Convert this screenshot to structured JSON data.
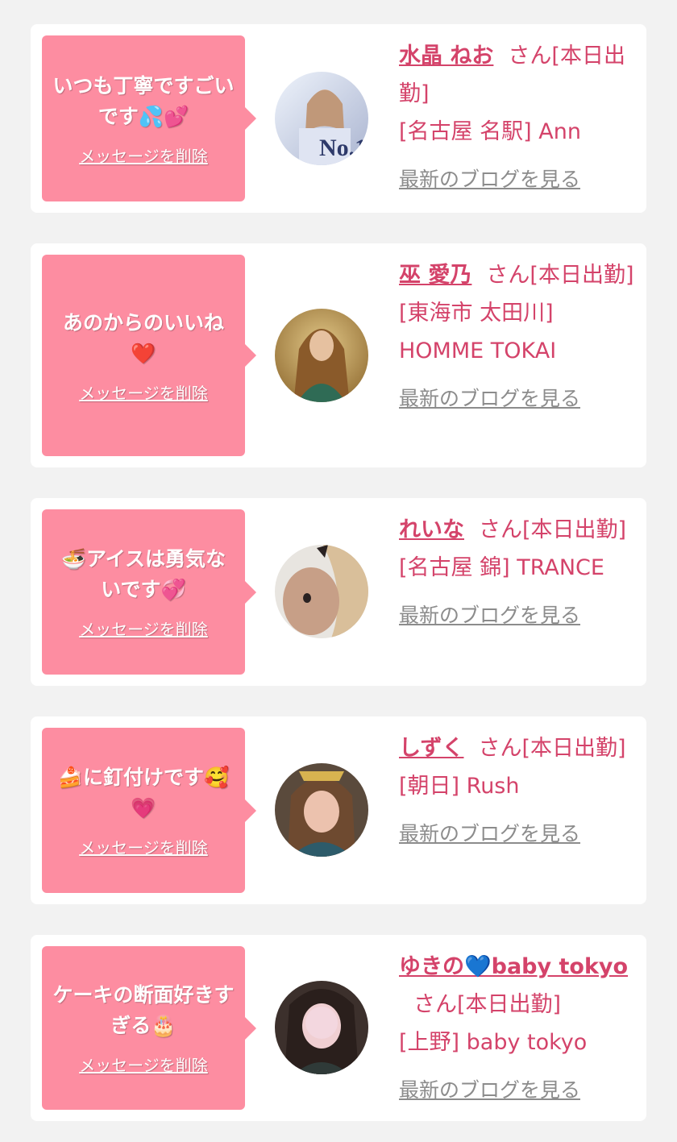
{
  "items": [
    {
      "message": "いつも丁寧ですごいです💦💕",
      "delete_label": "メッセージを削除",
      "name": "水晶 ねお",
      "suffix": "さん[本日出勤]",
      "shop": "[名古屋 名駅] Ann",
      "blog_label": "最新のブログを見る",
      "avatar_colors": [
        "#e8eef8",
        "#b9c4de",
        "#d8b7a3"
      ]
    },
    {
      "message": "あのからのいいね❤️",
      "delete_label": "メッセージを削除",
      "name": "巫 愛乃",
      "suffix": "さん[本日出勤]",
      "shop": "[東海市 太田川] HOMME TOKAI",
      "blog_label": "最新のブログを見る",
      "avatar_colors": [
        "#c9a860",
        "#7a5a2c",
        "#2f6b55"
      ]
    },
    {
      "message": "🍜アイスは勇気ないです💞",
      "delete_label": "メッセージを削除",
      "name": "れいな",
      "suffix": "さん[本日出勤]",
      "shop": "[名古屋 錦] TRANCE",
      "blog_label": "最新のブログを見る",
      "avatar_colors": [
        "#e6e3df",
        "#c59d88",
        "#3a3030"
      ]
    },
    {
      "message": "🍰に釘付けです🥰💗",
      "delete_label": "メッセージを削除",
      "name": "しずく",
      "suffix": "さん[本日出勤]",
      "shop": "[朝日] Rush",
      "blog_label": "最新のブログを見る",
      "avatar_colors": [
        "#6b5a4a",
        "#e6b9a7",
        "#2d5b6a"
      ]
    },
    {
      "message": "ケーキの断面好きすぎる🎂",
      "delete_label": "メッセージを削除",
      "name": "ゆきの💙baby tokyo",
      "suffix": "さん[本日出勤]",
      "shop": "[上野] baby tokyo",
      "blog_label": "最新のブログを見る",
      "avatar_colors": [
        "#4b3a35",
        "#e9c6c8",
        "#1f2a2a"
      ]
    }
  ],
  "colors": {
    "background": "#f2f2f2",
    "bubble": "#fd8da1",
    "accent": "#d4436a",
    "link_gray": "#8c8c8c"
  }
}
